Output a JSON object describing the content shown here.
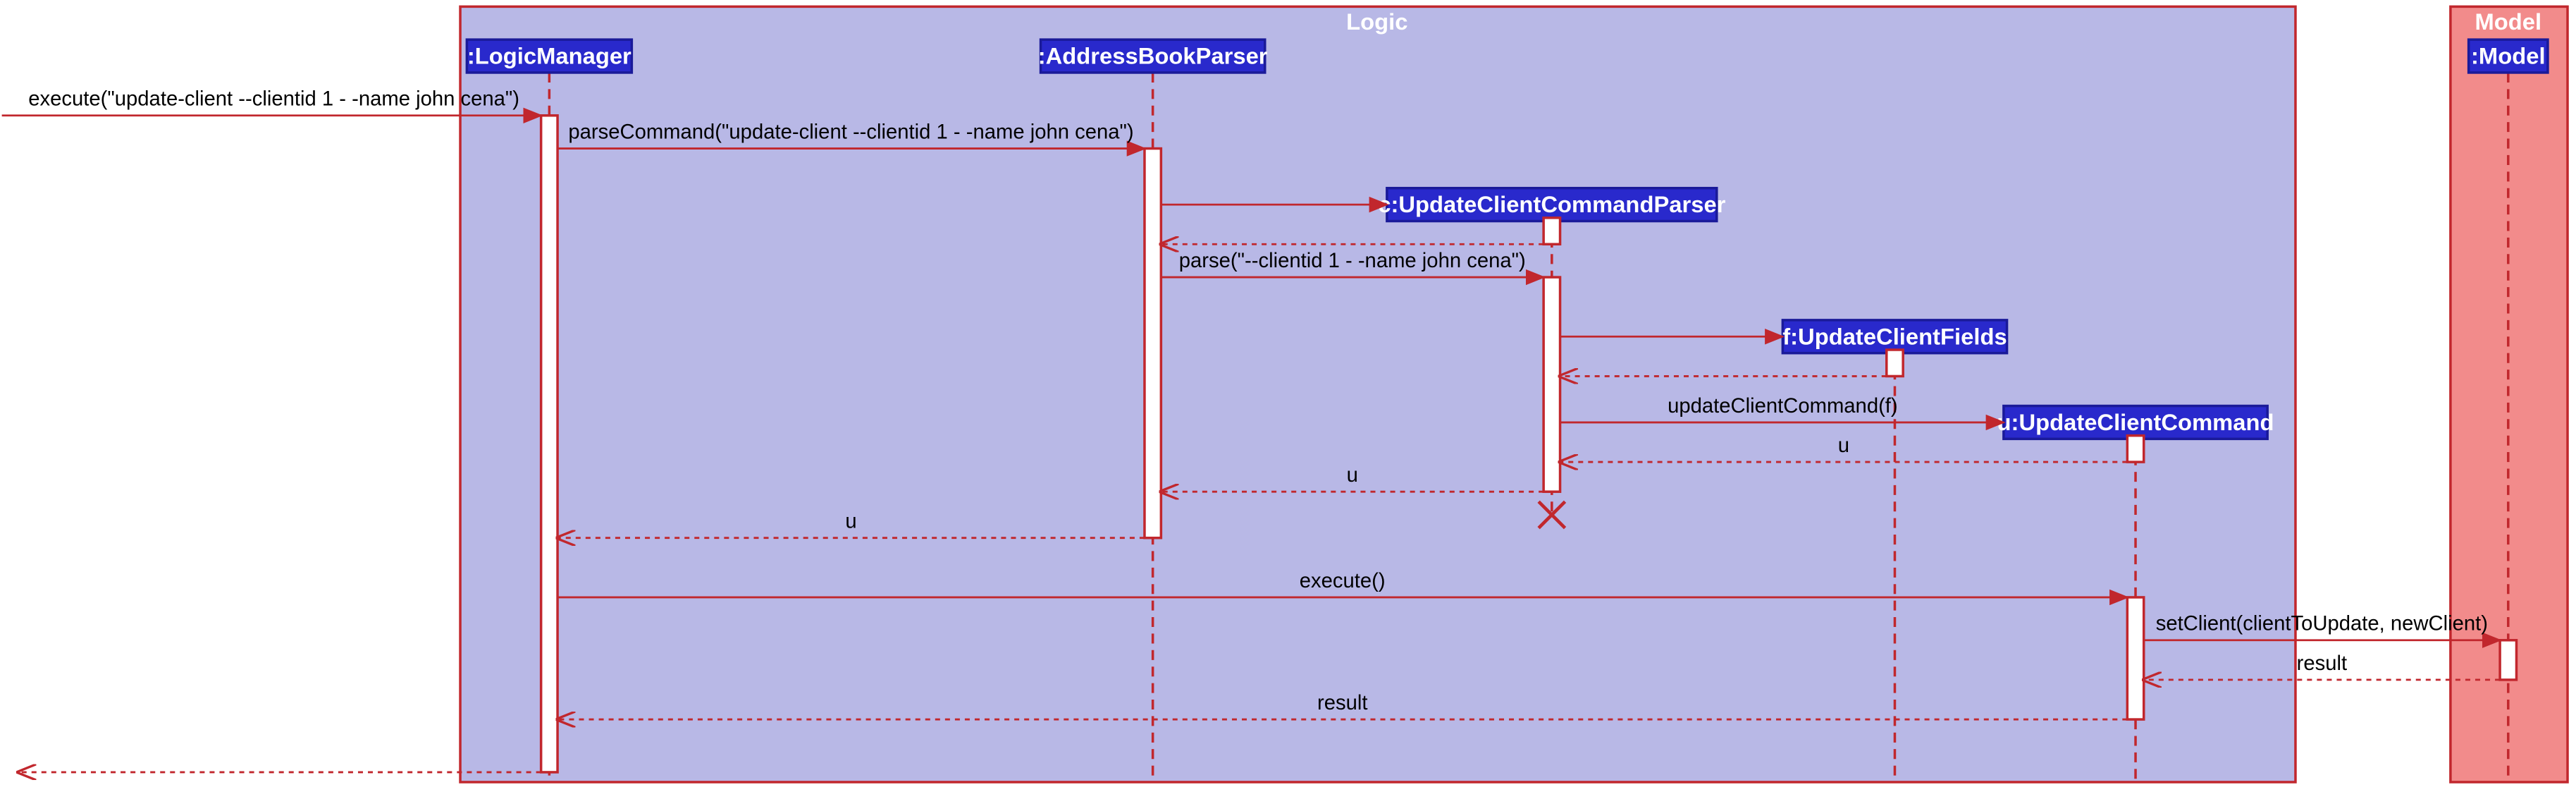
{
  "boxes": {
    "logic": {
      "title": "Logic"
    },
    "model": {
      "title": "Model"
    }
  },
  "participants": {
    "logicManager": ":LogicManager",
    "addressBookParser": ":AddressBookParser",
    "updateClientCommandParser": "c:UpdateClientCommandParser",
    "updateClientFields": "f:UpdateClientFields",
    "updateClientCommand": "u:UpdateClientCommand",
    "model": ":Model"
  },
  "messages": {
    "m1": "execute(\"update-client --clientid 1 - -name john cena\")",
    "m2": "parseCommand(\"update-client --clientid 1 - -name john cena\")",
    "m3": "",
    "m4": "",
    "m5": "parse(\"--clientid 1 - -name john cena\")",
    "m6": "",
    "m7": "",
    "m8": "updateClientCommand(f)",
    "m9": "u",
    "m10": "u",
    "m11": "u",
    "m12": "execute()",
    "m13": "setClient(clientToUpdate, newClient)",
    "m14": "result",
    "m15": "result",
    "m16": ""
  }
}
